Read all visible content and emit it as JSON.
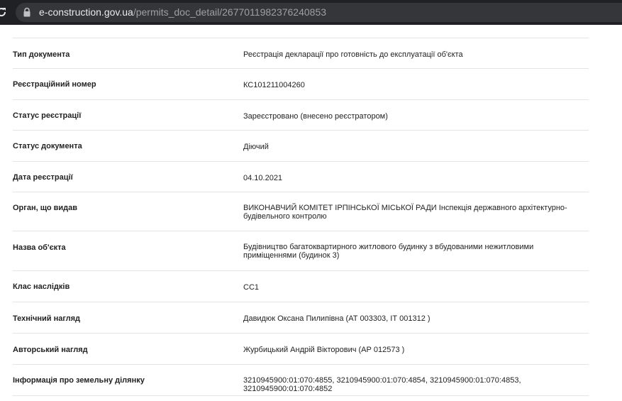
{
  "browser": {
    "url_domain": "e-construction.gov.ua",
    "url_path": "/permits_doc_detail/2677011982376240853"
  },
  "document_details": [
    {
      "label": "Тип документа",
      "value": "Реєстрація декларації про готовність до експлуатації об'єкта"
    },
    {
      "label": "Реєстраційний номер",
      "value": "КС101211004260"
    },
    {
      "label": "Статус реєстрації",
      "value": "Зареєстровано (внесено реєстратором)"
    },
    {
      "label": "Статус документа",
      "value": "Діючий"
    },
    {
      "label": "Дата реєстрації",
      "value": "04.10.2021"
    },
    {
      "label": "Орган, що видав",
      "value": "ВИКОНАВЧИЙ КОМІТЕТ ІРПІНСЬКОЇ МІСЬКОЇ РАДИ Інспекція державного архітектурно-будівельного контролю"
    },
    {
      "label": "Назва об'єкта",
      "value": "Будівництво багатоквартирного житлового будинку з вбудованими нежитловими приміщеннями (будинок 3)"
    },
    {
      "label": "Клас наслідків",
      "value": "СС1"
    },
    {
      "label": "Технічний нагляд",
      "value": "Давидюк Оксана Пилипівна (АТ 003303, ІТ 001312 )"
    },
    {
      "label": "Авторський нагляд",
      "value": "Журбицький Андрій Вікторович (АР 012573 )"
    },
    {
      "label": "Інформація про земельну ділянку",
      "value": "3210945900:01:070:4855, 3210945900:01:070:4854, 3210945900:01:070:4853, 3210945900:01:070:4852"
    }
  ]
}
